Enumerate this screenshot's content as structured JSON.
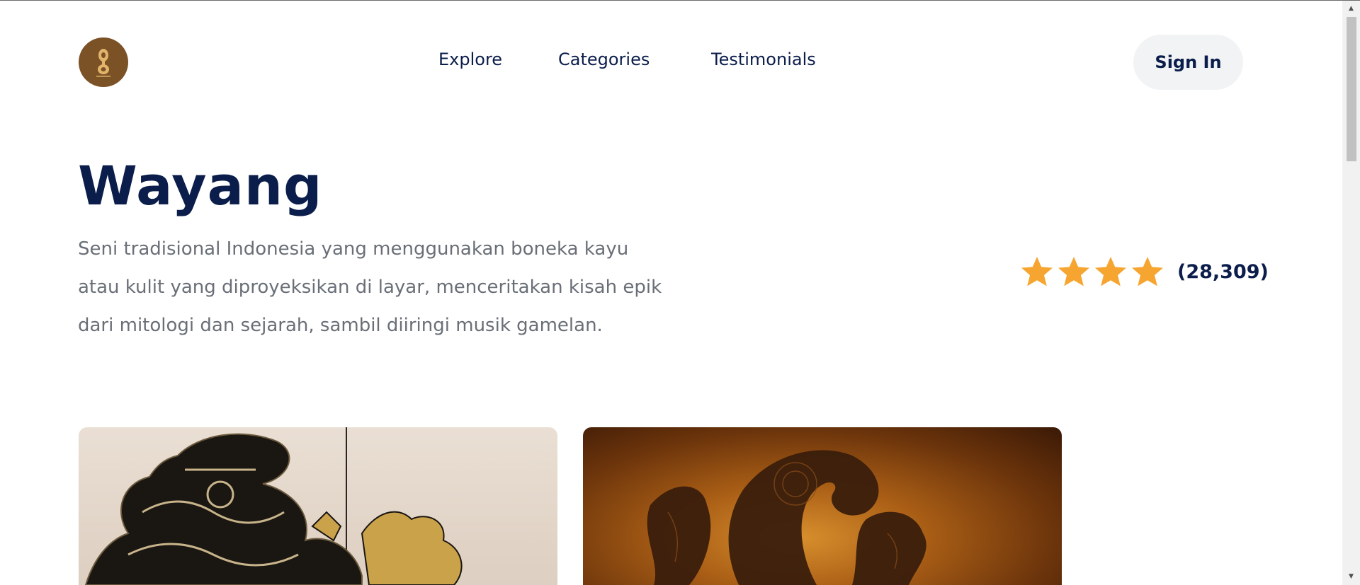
{
  "header": {
    "logo_icon": "gong-logo-icon",
    "nav": [
      {
        "label": "Explore"
      },
      {
        "label": "Categories"
      },
      {
        "label": "Testimonials"
      }
    ],
    "signin_label": "Sign In"
  },
  "hero": {
    "title": "Wayang",
    "description": "Seni tradisional Indonesia yang menggunakan boneka kayu atau kulit yang diproyeksikan di layar, menceritakan kisah epik dari mitologi dan sejarah, sambil diiringi musik gamelan.",
    "rating": {
      "stars": 4,
      "count_label": "(28,309)"
    }
  },
  "colors": {
    "primary_text": "#0b1d4a",
    "body_text": "#6a6f77",
    "star": "#f6a530",
    "logo_bg": "#7b5126",
    "button_bg": "#f2f3f5"
  },
  "gallery": [
    {
      "image": "wayang-kulit-puppet-image"
    },
    {
      "image": "gunungan-silhouette-image"
    }
  ]
}
